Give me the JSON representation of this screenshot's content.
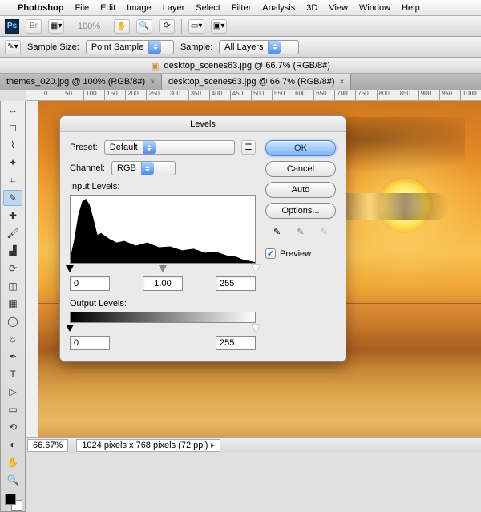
{
  "menubar": {
    "app": "Photoshop",
    "items": [
      "File",
      "Edit",
      "Image",
      "Layer",
      "Select",
      "Filter",
      "Analysis",
      "3D",
      "View",
      "Window",
      "Help"
    ]
  },
  "optionsBar1": {
    "zoom": "100%"
  },
  "optionsBar2": {
    "sampleSizeLabel": "Sample Size:",
    "sampleSizeValue": "Point Sample",
    "sampleLabel": "Sample:",
    "sampleValue": "All Layers"
  },
  "document": {
    "title": "desktop_scenes63.jpg @ 66.7% (RGB/8#)",
    "tabs": [
      {
        "label": "themes_020.jpg @ 100% (RGB/8#)",
        "active": false
      },
      {
        "label": "desktop_scenes63.jpg @ 66.7% (RGB/8#)",
        "active": true
      }
    ]
  },
  "rulers": {
    "marks": [
      "0",
      "50",
      "100",
      "150",
      "200",
      "250",
      "300",
      "350",
      "400",
      "450",
      "500",
      "550",
      "600",
      "650",
      "700",
      "750",
      "800",
      "850",
      "900",
      "950",
      "1000"
    ]
  },
  "tools": [
    "move",
    "marquee",
    "lasso",
    "wand",
    "crop",
    "eyedropper",
    "healing",
    "brush",
    "stamp",
    "history-brush",
    "eraser",
    "gradient",
    "blur",
    "dodge",
    "pen",
    "type",
    "path-select",
    "shape",
    "3d-rotate",
    "3d-orbit",
    "hand",
    "zoom"
  ],
  "toolGlyphs": [
    "↔",
    "◻",
    "⌇",
    "✦",
    "⌗",
    "✎",
    "✚",
    "🖌",
    "▟",
    "⟳",
    "◫",
    "▦",
    "◯",
    "☼",
    "✒",
    "T",
    "▷",
    "▭",
    "⟲",
    "◐",
    "✋",
    "🔍"
  ],
  "activeTool": "eyedropper",
  "levels": {
    "title": "Levels",
    "presetLabel": "Preset:",
    "presetValue": "Default",
    "channelLabel": "Channel:",
    "channelValue": "RGB",
    "inputLabel": "Input Levels:",
    "inputBlack": "0",
    "inputGamma": "1.00",
    "inputWhite": "255",
    "outputLabel": "Output Levels:",
    "outputBlack": "0",
    "outputWhite": "255",
    "buttons": {
      "ok": "OK",
      "cancel": "Cancel",
      "auto": "Auto",
      "options": "Options..."
    },
    "previewLabel": "Preview",
    "previewChecked": true
  },
  "status": {
    "zoom": "66.67%",
    "dims": "1024 pixels x 768 pixels (72 ppi)"
  }
}
